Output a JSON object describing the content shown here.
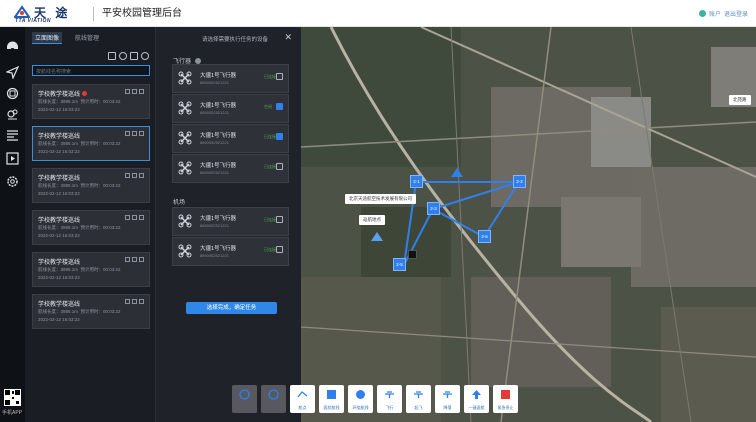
{
  "header": {
    "logo_cn": "天 途",
    "logo_en": "TTA VIATION",
    "system_title": "平安校园管理后台",
    "user_label": "账户",
    "logout_label": "退出登录"
  },
  "sidenav": {
    "icons": [
      "camera-icon",
      "navigation-icon",
      "grid-icon",
      "location-icon",
      "list-icon",
      "media-icon",
      "settings-icon"
    ],
    "app_label": "手机APP"
  },
  "route_panel": {
    "tabs": [
      {
        "label": "立面图像"
      },
      {
        "label": "航线管理"
      }
    ],
    "search_placeholder": "按航线名称搜索",
    "routes": [
      {
        "title": "学校教学楼巡线",
        "length": "航线长度：3985.1m",
        "time": "预计用时：00:03:22",
        "date": "2022-02-12 16:03:22",
        "alert": true
      },
      {
        "title": "学校教学楼巡线",
        "length": "航线长度：3985.1m",
        "time": "预计用时：00:03:22",
        "date": "2022-02-12 16:03:22",
        "alert": false
      },
      {
        "title": "学校教学楼巡线",
        "length": "航线长度：3985.1m",
        "time": "预计用时：00:03:22",
        "date": "2022-02-12 16:03:22",
        "alert": false
      },
      {
        "title": "学校教学楼巡线",
        "length": "航线长度：3985.1m",
        "time": "预计用时：00:03:22",
        "date": "2022-02-12 16:03:22",
        "alert": false
      },
      {
        "title": "学校教学楼巡线",
        "length": "航线长度：3985.1m",
        "time": "预计用时：00:03:22",
        "date": "2022-02-12 16:03:22",
        "alert": false
      },
      {
        "title": "学校教学楼巡线",
        "length": "航线长度：3985.1m",
        "time": "预计用时：00:03:22",
        "date": "2022-02-12 16:03:22",
        "alert": false
      }
    ]
  },
  "device_panel": {
    "title": "请选择需要执行任务的设备",
    "section_flying": "飞行器",
    "section_hangar": "机场",
    "flying": [
      {
        "name": "大疆1号飞行器",
        "sn": "8890052521221",
        "status": "已连接",
        "checked": false
      },
      {
        "name": "大疆1号飞行器",
        "sn": "8890052521221",
        "status": "空闲",
        "checked": true
      },
      {
        "name": "大疆1号飞行器",
        "sn": "8890052521221",
        "status": "已连接",
        "checked": true
      },
      {
        "name": "大疆1号飞行器",
        "sn": "8890052521221",
        "status": "已连接",
        "checked": false
      }
    ],
    "hangar": [
      {
        "name": "大疆1号飞行器",
        "sn": "8890052521221",
        "status": "已连接",
        "checked": false
      },
      {
        "name": "大疆1号飞行器",
        "sn": "8890052521221",
        "status": "已连接",
        "checked": false
      }
    ],
    "confirm_label": "选择完成，确定任务"
  },
  "map": {
    "callout_main": "北京天途航空技术发展有限公司",
    "callout_home": "返航地点",
    "callout_side": "北苑路",
    "waypoints": [
      "2-1",
      "2-2",
      "2-3",
      "2-6",
      "2-5"
    ],
    "tools": [
      {
        "icon": "history-icon",
        "label": "",
        "dim": true
      },
      {
        "icon": "map-icon",
        "label": "",
        "dim": true
      },
      {
        "icon": "waypoint-icon",
        "label": "航点",
        "dim": false
      },
      {
        "icon": "square-icon",
        "label": "面状航线",
        "dim": false
      },
      {
        "icon": "circle-icon",
        "label": "环绕航线",
        "dim": false
      },
      {
        "icon": "drone-icon",
        "label": "飞行",
        "dim": false
      },
      {
        "icon": "drone-icon",
        "label": "起飞",
        "dim": false
      },
      {
        "icon": "drone-icon",
        "label": "降落",
        "dim": false
      },
      {
        "icon": "return-icon",
        "label": "一键返航",
        "dim": false
      },
      {
        "icon": "stop-icon",
        "label": "紧急停止",
        "dim": false
      }
    ]
  },
  "colors": {
    "accent": "#2f80ed",
    "alert": "#e53935",
    "online": "#4caf50"
  }
}
